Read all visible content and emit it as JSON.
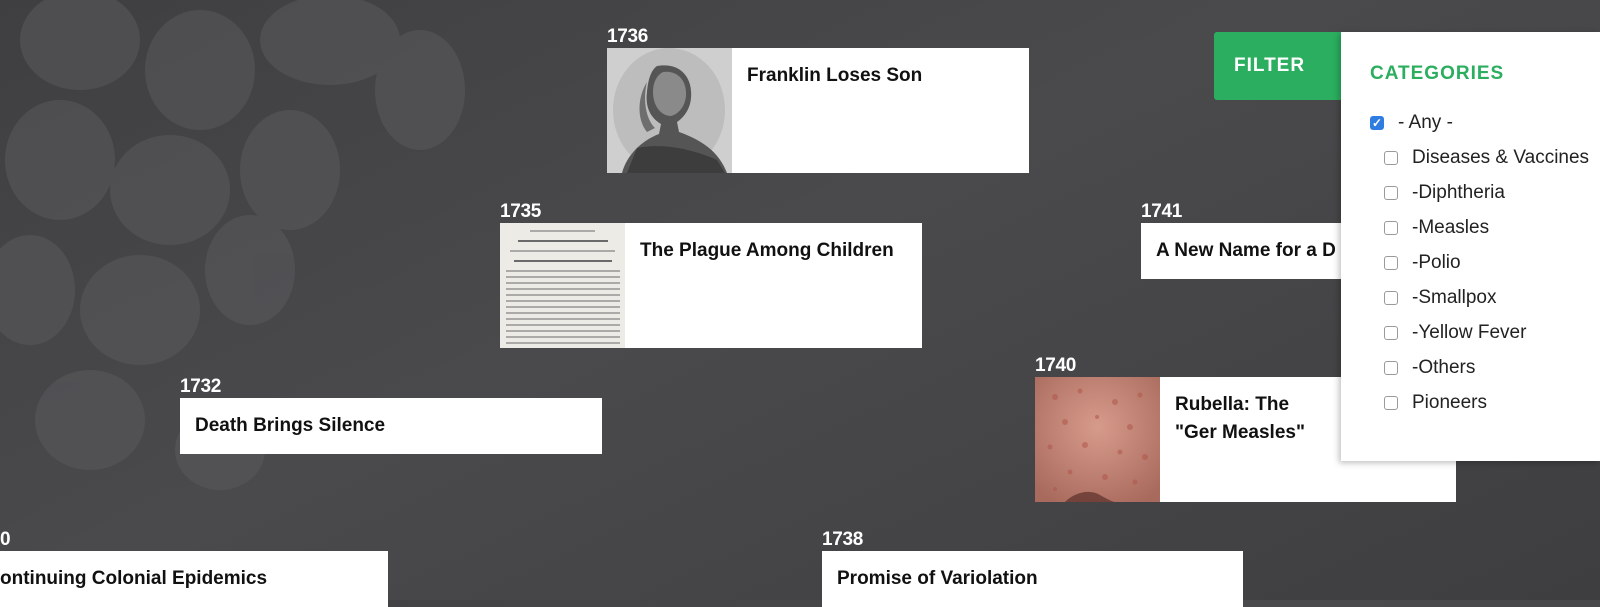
{
  "events": [
    {
      "year": "1736",
      "title": "Franklin Loses Son",
      "image": "franklin-portrait-image"
    },
    {
      "year": "1735",
      "title": "The Plague Among Children",
      "image": "proclamation-document-image"
    },
    {
      "year": "1732",
      "title": "Death Brings Silence"
    },
    {
      "year": "1741",
      "title": "A New Name for a D"
    },
    {
      "year": "1740",
      "title": "Rubella: The \"Ger Measles\"",
      "image": "rubella-rash-image"
    },
    {
      "year": "0",
      "title": "ontinuing Colonial Epidemics"
    },
    {
      "year": "1738",
      "title": "Promise of Variolation"
    }
  ],
  "filter": {
    "button_label": "FILTER",
    "heading": "CATEGORIES",
    "categories": [
      {
        "label": "- Any -",
        "checked": true
      },
      {
        "label": "Diseases & Vaccines",
        "checked": false
      },
      {
        "label": "-Diphtheria",
        "checked": false
      },
      {
        "label": "-Measles",
        "checked": false
      },
      {
        "label": "-Polio",
        "checked": false
      },
      {
        "label": "-Smallpox",
        "checked": false
      },
      {
        "label": "-Yellow Fever",
        "checked": false
      },
      {
        "label": "-Others",
        "checked": false
      },
      {
        "label": "Pioneers",
        "checked": false
      }
    ]
  },
  "colors": {
    "accent": "#2bae5f",
    "checkbox_checked": "#2f7de1",
    "background": "#444446"
  }
}
